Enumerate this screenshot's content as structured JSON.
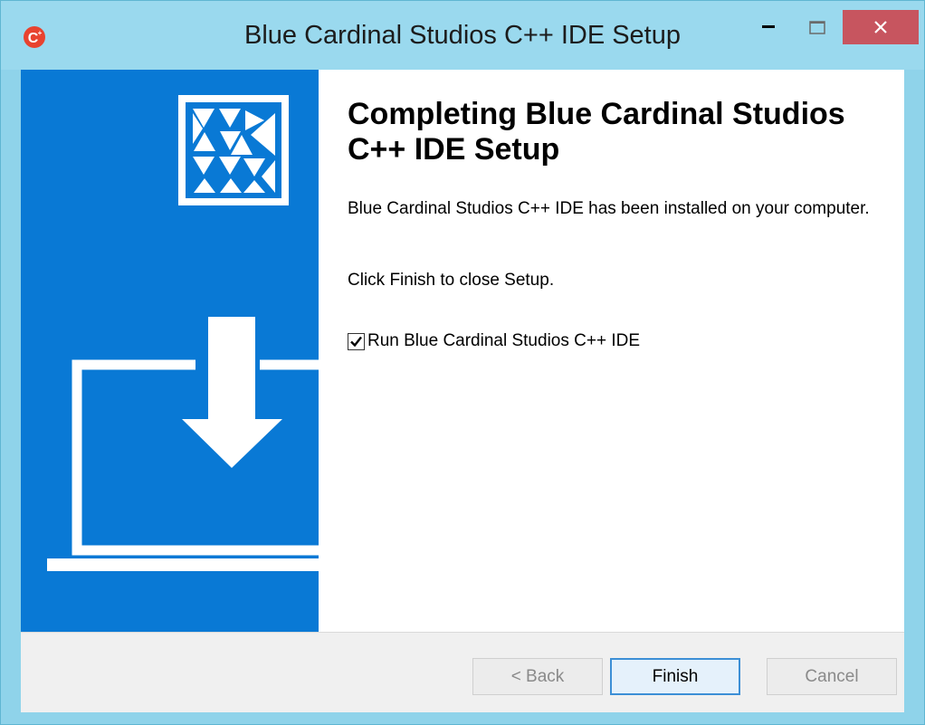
{
  "window": {
    "title": "Blue Cardinal Studios C++ IDE Setup",
    "app_icon_letter": "C",
    "controls": {
      "minimize_icon": "minimize-icon",
      "maximize_icon": "maximize-icon",
      "close_icon": "close-icon"
    },
    "colors": {
      "titlebar": "#9ad9ee",
      "close_button": "#c7555f",
      "sidebar": "#0979d5"
    }
  },
  "sidebar": {
    "logo_icon": "blue-cardinal-logo-icon",
    "illustration": "laptop-download-icon"
  },
  "main": {
    "heading": "Completing Blue Cardinal Studios C++ IDE Setup",
    "paragraph1": "Blue Cardinal Studios C++ IDE has been installed on your computer.",
    "paragraph2": "Click Finish to close Setup.",
    "run_checkbox": {
      "label": "Run Blue Cardinal Studios C++ IDE",
      "checked": true
    }
  },
  "footer": {
    "back_label": "< Back",
    "finish_label": "Finish",
    "cancel_label": "Cancel"
  }
}
